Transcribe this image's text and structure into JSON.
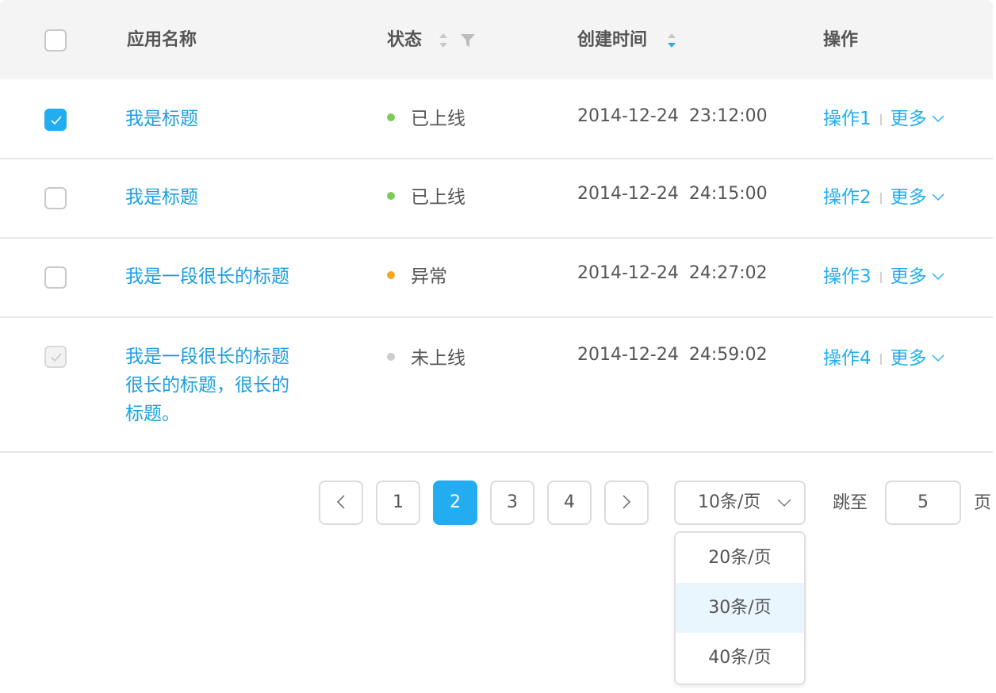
{
  "columns": {
    "name": "应用名称",
    "status": "状态",
    "created": "创建时间",
    "ops": "操作"
  },
  "colors": {
    "primary": "#23adf0",
    "link": "#1c9ee3",
    "online": "#7ecb5a",
    "error": "#f5a623",
    "offline": "#cccccc"
  },
  "rows": [
    {
      "checked": true,
      "disabled": false,
      "name": "我是标题",
      "status": "已上线",
      "status_color": "online",
      "created": "2014-12-24  23:12:00",
      "op": "操作1",
      "more": "更多"
    },
    {
      "checked": false,
      "disabled": false,
      "name": "我是标题",
      "status": "已上线",
      "status_color": "online",
      "created": "2014-12-24  24:15:00",
      "op": "操作2",
      "more": "更多"
    },
    {
      "checked": false,
      "disabled": false,
      "name": "我是一段很长的标题",
      "status": "异常",
      "status_color": "error",
      "created": "2014-12-24  24:27:02",
      "op": "操作3",
      "more": "更多"
    },
    {
      "checked": true,
      "disabled": true,
      "name_lines": [
        "我是一段很长的标题",
        "很长的标题，很长的",
        "标题。"
      ],
      "status": "未上线",
      "status_color": "offline",
      "created": "2014-12-24  24:59:02",
      "op": "操作4",
      "more": "更多"
    }
  ],
  "pagination": {
    "prev_icon": "chevron-left-icon",
    "next_icon": "chevron-right-icon",
    "pages": [
      "1",
      "2",
      "3",
      "4"
    ],
    "current": "2",
    "page_size": "10条/页",
    "page_size_options": [
      "20条/页",
      "30条/页",
      "40条/页"
    ],
    "highlighted_option": "30条/页",
    "jump_label": "跳至",
    "jump_value": "5",
    "jump_suffix": "页"
  }
}
